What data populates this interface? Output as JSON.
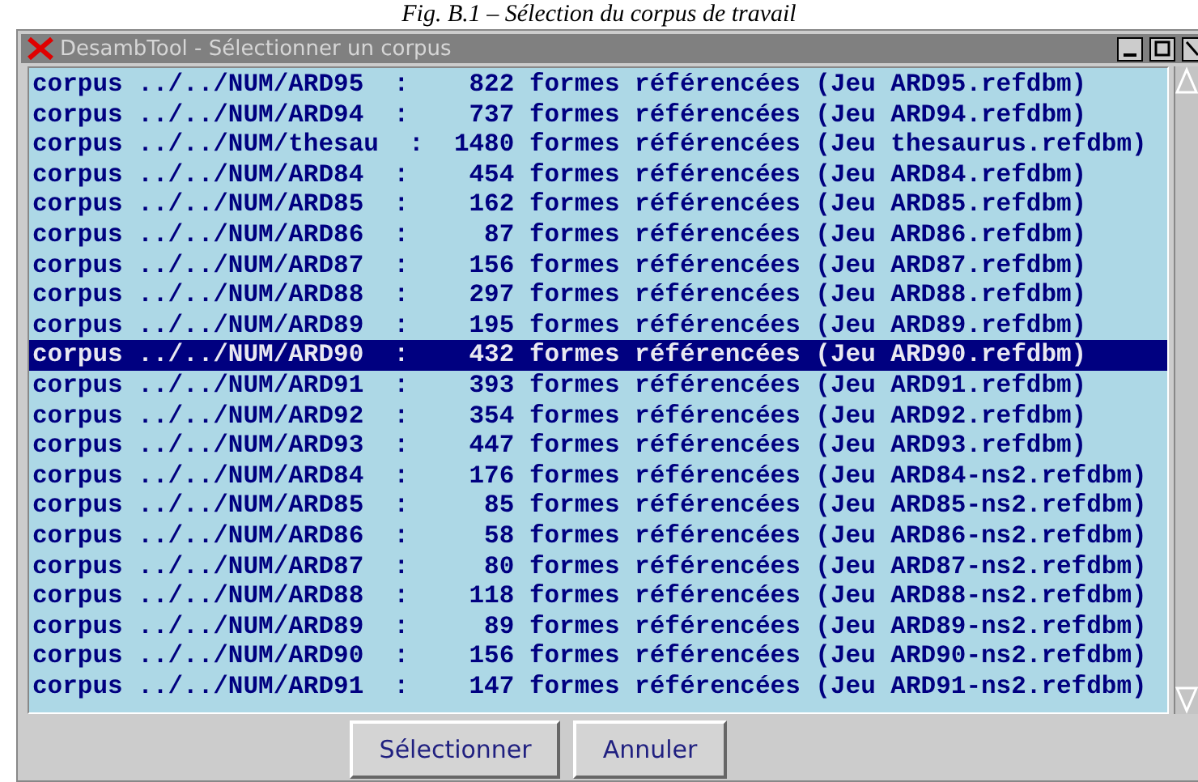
{
  "caption": "Fig. B.1 – Sélection du corpus de travail",
  "window": {
    "title": "DesambTool - Sélectionner un corpus"
  },
  "rows": [
    {
      "text": "corpus ../../NUM/ARD95  :    822 formes référencées (Jeu ARD95.refdbm)",
      "selected": false
    },
    {
      "text": "corpus ../../NUM/ARD94  :    737 formes référencées (Jeu ARD94.refdbm)",
      "selected": false
    },
    {
      "text": "corpus ../../NUM/thesau  :  1480 formes référencées (Jeu thesaurus.refdbm)",
      "selected": false
    },
    {
      "text": "corpus ../../NUM/ARD84  :    454 formes référencées (Jeu ARD84.refdbm)",
      "selected": false
    },
    {
      "text": "corpus ../../NUM/ARD85  :    162 formes référencées (Jeu ARD85.refdbm)",
      "selected": false
    },
    {
      "text": "corpus ../../NUM/ARD86  :     87 formes référencées (Jeu ARD86.refdbm)",
      "selected": false
    },
    {
      "text": "corpus ../../NUM/ARD87  :    156 formes référencées (Jeu ARD87.refdbm)",
      "selected": false
    },
    {
      "text": "corpus ../../NUM/ARD88  :    297 formes référencées (Jeu ARD88.refdbm)",
      "selected": false
    },
    {
      "text": "corpus ../../NUM/ARD89  :    195 formes référencées (Jeu ARD89.refdbm)",
      "selected": false
    },
    {
      "text": "corpus ../../NUM/ARD90  :    432 formes référencées (Jeu ARD90.refdbm)",
      "selected": true
    },
    {
      "text": "corpus ../../NUM/ARD91  :    393 formes référencées (Jeu ARD91.refdbm)",
      "selected": false
    },
    {
      "text": "corpus ../../NUM/ARD92  :    354 formes référencées (Jeu ARD92.refdbm)",
      "selected": false
    },
    {
      "text": "corpus ../../NUM/ARD93  :    447 formes référencées (Jeu ARD93.refdbm)",
      "selected": false
    },
    {
      "text": "corpus ../../NUM/ARD84  :    176 formes référencées (Jeu ARD84-ns2.refdbm)",
      "selected": false
    },
    {
      "text": "corpus ../../NUM/ARD85  :     85 formes référencées (Jeu ARD85-ns2.refdbm)",
      "selected": false
    },
    {
      "text": "corpus ../../NUM/ARD86  :     58 formes référencées (Jeu ARD86-ns2.refdbm)",
      "selected": false
    },
    {
      "text": "corpus ../../NUM/ARD87  :     80 formes référencées (Jeu ARD87-ns2.refdbm)",
      "selected": false
    },
    {
      "text": "corpus ../../NUM/ARD88  :    118 formes référencées (Jeu ARD88-ns2.refdbm)",
      "selected": false
    },
    {
      "text": "corpus ../../NUM/ARD89  :     89 formes référencées (Jeu ARD89-ns2.refdbm)",
      "selected": false
    },
    {
      "text": "corpus ../../NUM/ARD90  :    156 formes référencées (Jeu ARD90-ns2.refdbm)",
      "selected": false
    },
    {
      "text": "corpus ../../NUM/ARD91  :    147 formes référencées (Jeu ARD91-ns2.refdbm)",
      "selected": false
    }
  ],
  "buttons": [
    "Sélectionner",
    "Annuler"
  ]
}
